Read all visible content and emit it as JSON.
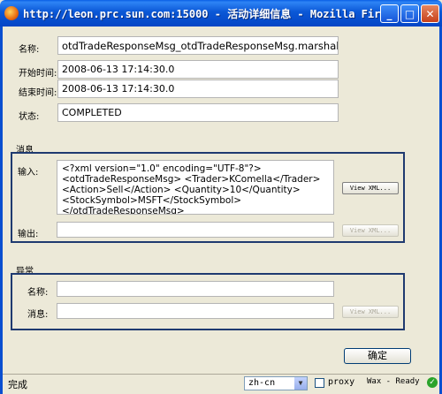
{
  "window": {
    "title": "http://leon.prc.sun.com:15000 - 活动详细信息 - Mozilla Fir...",
    "minimize_glyph": "_",
    "maximize_glyph": "□",
    "close_glyph": "✕"
  },
  "form": {
    "name_label": "名称:",
    "name_value": "otdTradeResponseMsg_otdTradeResponseMsg.marshalToString",
    "start_label": "开始时间:",
    "start_value": "2008-06-13 17:14:30.0",
    "end_label": "结束时间:",
    "end_value": "2008-06-13 17:14:30.0",
    "status_label": "状态:",
    "status_value": "COMPLETED"
  },
  "message": {
    "title": "消息",
    "input_label": "输入:",
    "input_xml": "<?xml version=\"1.0\" encoding=\"UTF-8\"?>\n<otdTradeResponseMsg> <Trader>KComella</Trader>\n<Action>Sell</Action> <Quantity>10</Quantity>\n<StockSymbol>MSFT</StockSymbol>\n</otdTradeResponseMsg>",
    "input_view_button": "View XML...",
    "output_label": "输出:",
    "output_value": "",
    "output_view_button": "View XML..."
  },
  "exception": {
    "title": "异常",
    "name_label": "名称:",
    "name_value": "",
    "message_label": "消息:",
    "message_value": "",
    "view_button": "View XML..."
  },
  "ok_button": "确定",
  "statusbar": {
    "status": "完成",
    "language": "zh-cn",
    "proxy_label": "proxy",
    "wax_status": "Wax - Ready",
    "ok_glyph": "✓"
  }
}
